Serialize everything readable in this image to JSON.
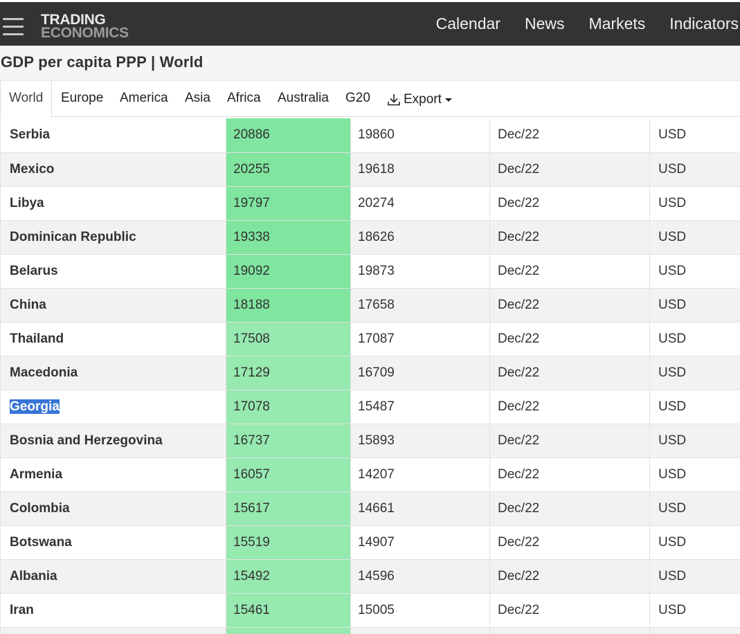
{
  "header": {
    "logo_line1": "TRADING",
    "logo_line2": "ECONOMICS",
    "nav": [
      "Calendar",
      "News",
      "Markets",
      "Indicators"
    ]
  },
  "page_title": "GDP per capita PPP | World",
  "tabs": [
    "World",
    "Europe",
    "America",
    "Asia",
    "Africa",
    "Australia",
    "G20"
  ],
  "export_label": "Export",
  "table": {
    "rows": [
      {
        "country": "Serbia",
        "last": "20886",
        "previous": "19860",
        "reference": "Dec/22",
        "unit": "USD",
        "shade": 1
      },
      {
        "country": "Mexico",
        "last": "20255",
        "previous": "19618",
        "reference": "Dec/22",
        "unit": "USD",
        "shade": 1
      },
      {
        "country": "Libya",
        "last": "19797",
        "previous": "20274",
        "reference": "Dec/22",
        "unit": "USD",
        "shade": 1
      },
      {
        "country": "Dominican Republic",
        "last": "19338",
        "previous": "18626",
        "reference": "Dec/22",
        "unit": "USD",
        "shade": 1
      },
      {
        "country": "Belarus",
        "last": "19092",
        "previous": "19873",
        "reference": "Dec/22",
        "unit": "USD",
        "shade": 1
      },
      {
        "country": "China",
        "last": "18188",
        "previous": "17658",
        "reference": "Dec/22",
        "unit": "USD",
        "shade": 1
      },
      {
        "country": "Thailand",
        "last": "17508",
        "previous": "17087",
        "reference": "Dec/22",
        "unit": "USD",
        "shade": 2
      },
      {
        "country": "Macedonia",
        "last": "17129",
        "previous": "16709",
        "reference": "Dec/22",
        "unit": "USD",
        "shade": 2
      },
      {
        "country": "Georgia",
        "last": "17078",
        "previous": "15487",
        "reference": "Dec/22",
        "unit": "USD",
        "shade": 2,
        "selected": true
      },
      {
        "country": "Bosnia and Herzegovina",
        "last": "16737",
        "previous": "15893",
        "reference": "Dec/22",
        "unit": "USD",
        "shade": 2
      },
      {
        "country": "Armenia",
        "last": "16057",
        "previous": "14207",
        "reference": "Dec/22",
        "unit": "USD",
        "shade": 2
      },
      {
        "country": "Colombia",
        "last": "15617",
        "previous": "14661",
        "reference": "Dec/22",
        "unit": "USD",
        "shade": 2
      },
      {
        "country": "Botswana",
        "last": "15519",
        "previous": "14907",
        "reference": "Dec/22",
        "unit": "USD",
        "shade": 2
      },
      {
        "country": "Albania",
        "last": "15492",
        "previous": "14596",
        "reference": "Dec/22",
        "unit": "USD",
        "shade": 2
      },
      {
        "country": "Iran",
        "last": "15461",
        "previous": "15005",
        "reference": "Dec/22",
        "unit": "USD",
        "shade": 2
      }
    ]
  },
  "colors": {
    "navbar": "#333333",
    "last_col_dark": "#80e59f",
    "last_col_light": "#96e9af",
    "selection": "#3875d7"
  },
  "icons": [
    "hamburger-menu-icon",
    "download-icon",
    "caret-down-icon"
  ]
}
